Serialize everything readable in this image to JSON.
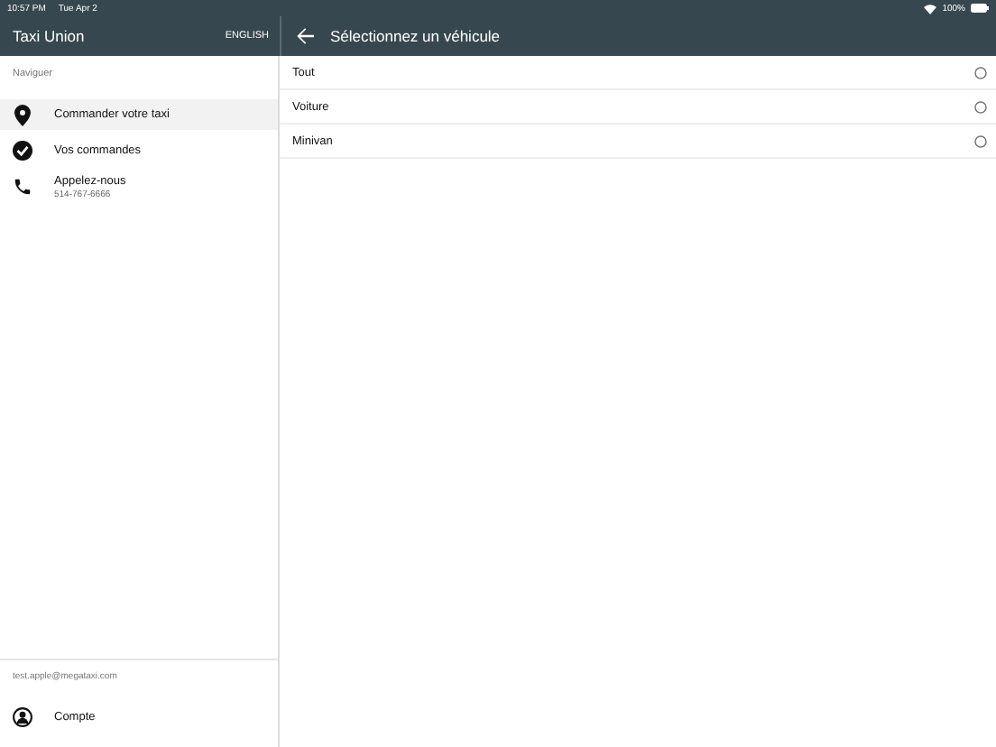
{
  "status_bar": {
    "time": "10:57 PM",
    "date": "Tue Apr 2",
    "battery_text": "100%"
  },
  "sidebar": {
    "title": "Taxi Union",
    "language_button": "ENGLISH",
    "section_label": "Naviguer",
    "items": [
      {
        "kind": "pin",
        "label": "Commander votre taxi",
        "selected": true
      },
      {
        "kind": "check",
        "label": "Vos commandes",
        "selected": false
      },
      {
        "kind": "phone",
        "label": "Appelez-nous",
        "subtitle": "514-767-6666",
        "selected": false
      }
    ],
    "email": "test.apple@megataxi.com",
    "account": {
      "label": "Compte"
    }
  },
  "main": {
    "title": "Sélectionnez un véhicule",
    "options": [
      {
        "label": "Tout",
        "selected": false
      },
      {
        "label": "Voiture",
        "selected": false
      },
      {
        "label": "Minivan",
        "selected": false
      }
    ]
  }
}
